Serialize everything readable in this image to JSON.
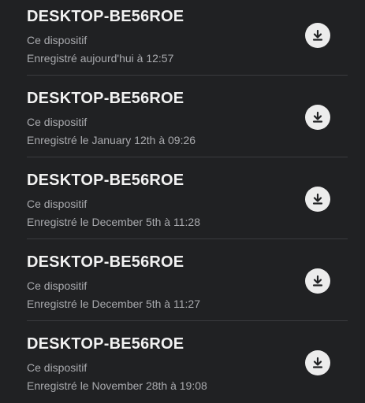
{
  "backups": [
    {
      "name": "DESKTOP-BE56ROE",
      "device": "Ce dispositif",
      "saved": "Enregistré aujourd'hui à 12:57",
      "action_icon": "download-icon"
    },
    {
      "name": "DESKTOP-BE56ROE",
      "device": "Ce dispositif",
      "saved": "Enregistré le January 12th à 09:26",
      "action_icon": "download-icon"
    },
    {
      "name": "DESKTOP-BE56ROE",
      "device": "Ce dispositif",
      "saved": "Enregistré le December 5th à 11:28",
      "action_icon": "download-icon"
    },
    {
      "name": "DESKTOP-BE56ROE",
      "device": "Ce dispositif",
      "saved": "Enregistré le December 5th à 11:27",
      "action_icon": "download-icon"
    },
    {
      "name": "DESKTOP-BE56ROE",
      "device": "Ce dispositif",
      "saved": "Enregistré le November 28th à 19:08",
      "action_icon": "download-icon"
    }
  ],
  "colors": {
    "background": "#202123",
    "title": "#f2f2f2",
    "subtitle": "#a9aaae",
    "divider": "#3a3b3e",
    "button_bg": "#ececec",
    "button_icon": "#202123"
  }
}
